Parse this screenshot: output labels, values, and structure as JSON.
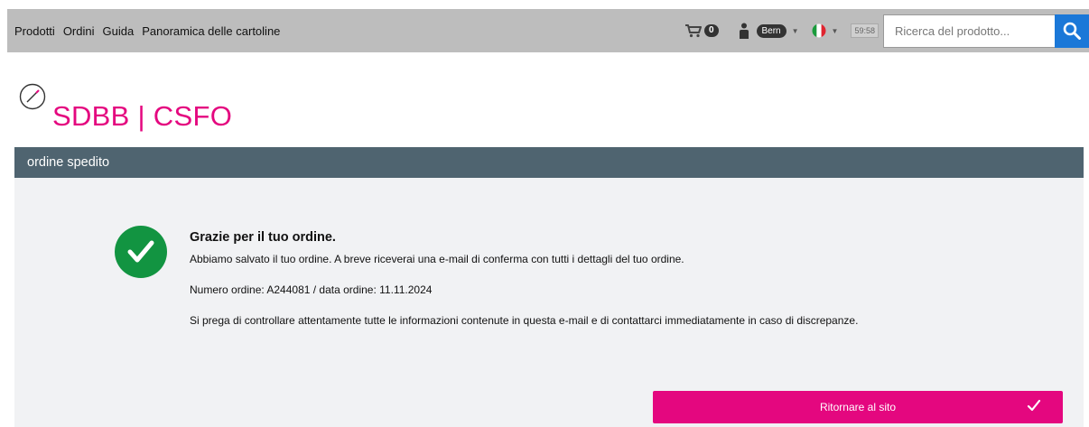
{
  "nav": {
    "links": [
      "Prodotti",
      "Ordini",
      "Guida",
      "Panoramica delle cartoline"
    ]
  },
  "toolbar": {
    "cart_icon": "shopping-cart-icon",
    "cart_count": "0",
    "user_icon": "user-icon",
    "location_label": "Bern",
    "language_icon": "italian-flag-icon",
    "session_timer": "59:58",
    "search": {
      "placeholder": "Ricerca del prodotto...",
      "value": ""
    },
    "search_icon": "search-icon"
  },
  "logo": {
    "text": "SDBB | CSFO",
    "icon": "compass-icon"
  },
  "panel": {
    "title": "ordine spedito",
    "heading": "Grazie per il tuo ordine.",
    "line1": "Abbiamo salvato il tuo ordine. A breve riceverai una e-mail di conferma con tutti i dettagli del tuo ordine.",
    "line2": "Numero ordine: A244081 / data ordine: 11.11.2024",
    "line3": "Si prega di controllare attentamente tutte le informazioni contenute in questa e-mail e di contattarci immediatamente in caso di discrepanze.",
    "return_button": "Ritornare al sito"
  },
  "colors": {
    "brand_pink": "#e4077f",
    "success_green": "#129441",
    "header_slate": "#4f6470",
    "search_blue": "#1b78d8"
  }
}
